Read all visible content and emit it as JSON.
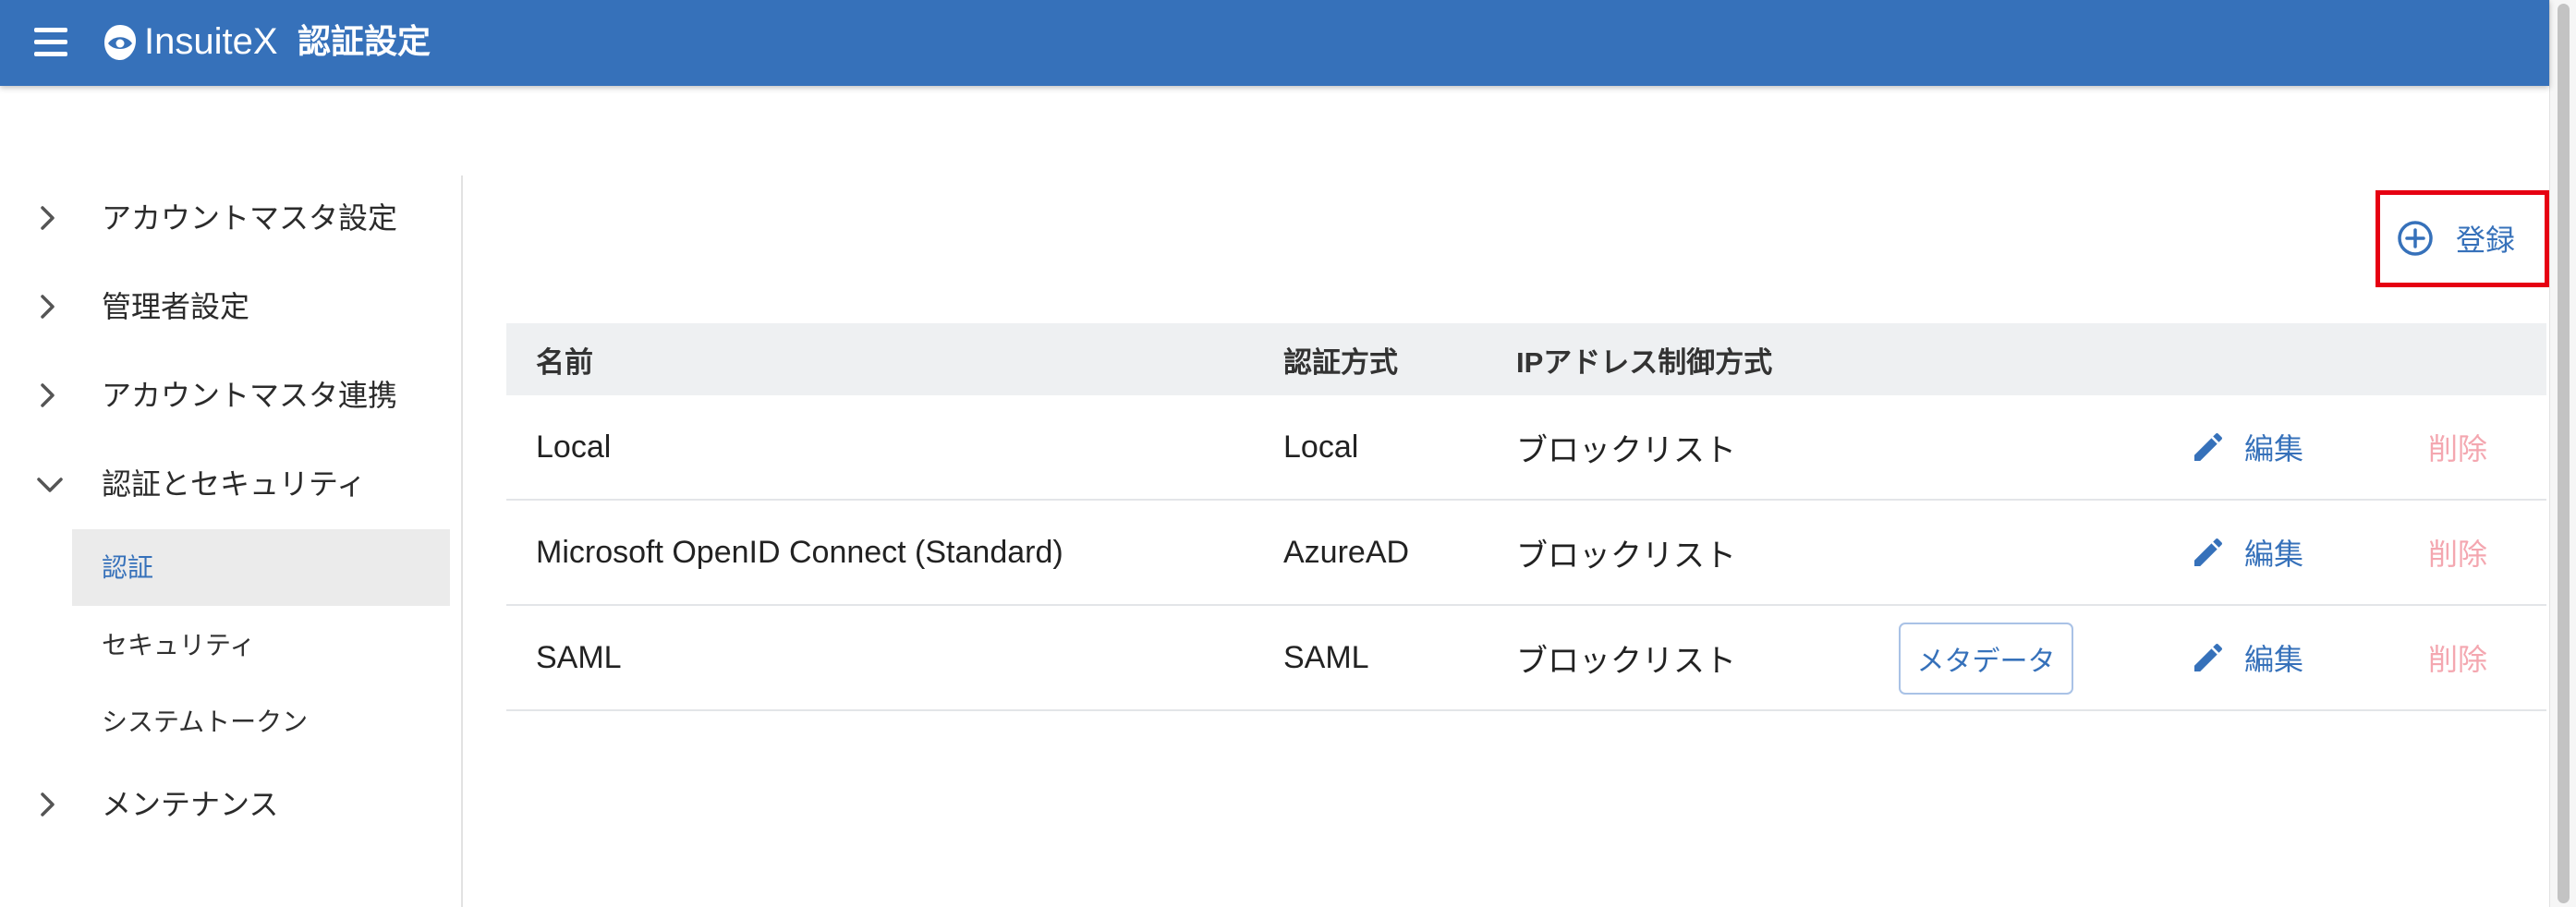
{
  "header": {
    "menu_icon": "hamburger-menu-icon",
    "logo_icon": "insuitex-logo-icon",
    "app_name": "InsuiteX",
    "page_title": "認証設定"
  },
  "sidebar": {
    "items": [
      {
        "label": "アカウントマスタ設定",
        "icon": "chevron-right-icon"
      },
      {
        "label": "管理者設定",
        "icon": "chevron-right-icon"
      },
      {
        "label": "アカウントマスタ連携",
        "icon": "chevron-right-icon"
      },
      {
        "label": "認証とセキュリティ",
        "icon": "chevron-down-icon",
        "expanded": true,
        "children": [
          {
            "label": "認証",
            "selected": true
          },
          {
            "label": "セキュリティ"
          },
          {
            "label": "システムトークン"
          }
        ]
      },
      {
        "label": "メンテナンス",
        "icon": "chevron-right-icon"
      }
    ]
  },
  "main": {
    "register_button": {
      "label": "登録",
      "icon": "plus-circle-icon"
    },
    "table": {
      "columns": [
        "名前",
        "認証方式",
        "IPアドレス制御方式"
      ],
      "rows": [
        {
          "name": "Local",
          "auth_method": "Local",
          "ip_control": "ブロックリスト",
          "edit_label": "編集",
          "delete_label": "削除"
        },
        {
          "name": "Microsoft OpenID Connect (Standard)",
          "auth_method": "AzureAD",
          "ip_control": "ブロックリスト",
          "edit_label": "編集",
          "delete_label": "削除"
        },
        {
          "name": "SAML",
          "auth_method": "SAML",
          "ip_control": "ブロックリスト",
          "metadata_label": "メタデータ",
          "edit_label": "編集",
          "delete_label": "削除"
        }
      ]
    }
  },
  "colors": {
    "header_bg": "#3671ba",
    "link": "#3671ba",
    "delete_text": "#f4a7b0",
    "highlight": "#e60012",
    "selected_nav_bg": "#ebebeb",
    "thead_bg": "#eef0f2"
  }
}
